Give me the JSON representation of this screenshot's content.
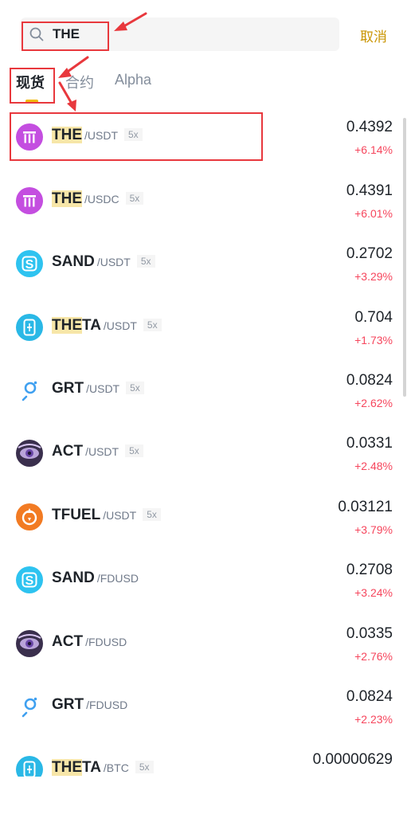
{
  "search": {
    "value": "THE",
    "cancel_label": "取消"
  },
  "tabs": [
    {
      "label": "现货"
    },
    {
      "label": "合约"
    },
    {
      "label": "Alpha"
    }
  ],
  "highlight_text": "THE",
  "rows": [
    {
      "base": "THE",
      "quote": "/USDT",
      "leverage": "5x",
      "price": "0.4392",
      "change": "+6.14%",
      "icon": "the-coin-icon"
    },
    {
      "base": "THE",
      "quote": "/USDC",
      "leverage": "5x",
      "price": "0.4391",
      "change": "+6.01%",
      "icon": "the-coin-icon"
    },
    {
      "base": "SAND",
      "quote": "/USDT",
      "leverage": "5x",
      "price": "0.2702",
      "change": "+3.29%",
      "icon": "sand-coin-icon"
    },
    {
      "base": "THETA",
      "quote": "/USDT",
      "leverage": "5x",
      "price": "0.704",
      "change": "+1.73%",
      "icon": "theta-coin-icon"
    },
    {
      "base": "GRT",
      "quote": "/USDT",
      "leverage": "5x",
      "price": "0.0824",
      "change": "+2.62%",
      "icon": "grt-coin-icon"
    },
    {
      "base": "ACT",
      "quote": "/USDT",
      "leverage": "5x",
      "price": "0.0331",
      "change": "+2.48%",
      "icon": "act-coin-icon"
    },
    {
      "base": "TFUEL",
      "quote": "/USDT",
      "leverage": "5x",
      "price": "0.03121",
      "change": "+3.79%",
      "icon": "tfuel-coin-icon"
    },
    {
      "base": "SAND",
      "quote": "/FDUSD",
      "leverage": "",
      "price": "0.2708",
      "change": "+3.24%",
      "icon": "sand-coin-icon"
    },
    {
      "base": "ACT",
      "quote": "/FDUSD",
      "leverage": "",
      "price": "0.0335",
      "change": "+2.76%",
      "icon": "act-coin-icon"
    },
    {
      "base": "GRT",
      "quote": "/FDUSD",
      "leverage": "",
      "price": "0.0824",
      "change": "+2.23%",
      "icon": "grt-coin-icon"
    },
    {
      "base": "THETA",
      "quote": "/BTC",
      "leverage": "5x",
      "price": "0.00000629",
      "change": "",
      "icon": "theta-coin-icon"
    }
  ],
  "colors": {
    "accent": "#c99400",
    "tab_indicator": "#f0b90b",
    "negative_change": "#f6465d",
    "highlight": "#f7e6a8",
    "annotation": "#e8383d"
  }
}
